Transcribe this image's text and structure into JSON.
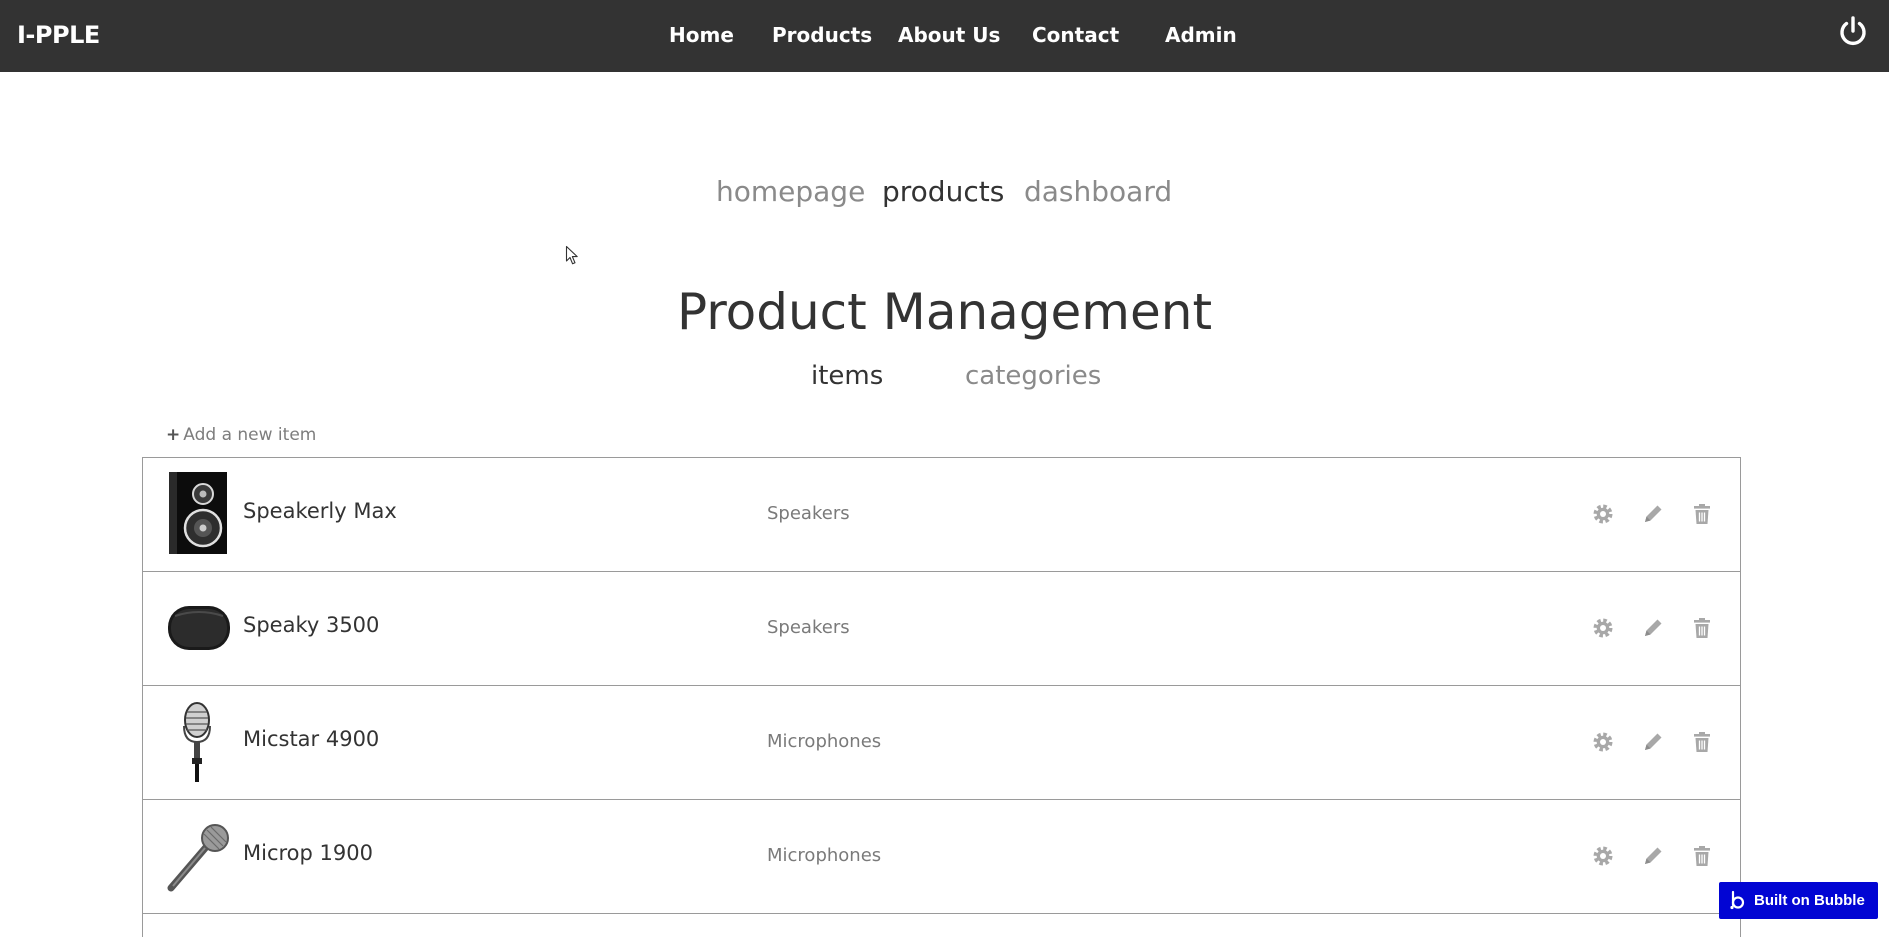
{
  "header": {
    "brand": "I-PPLE",
    "nav": [
      {
        "label": "Home"
      },
      {
        "label": "Products"
      },
      {
        "label": "About Us"
      },
      {
        "label": "Contact"
      },
      {
        "label": "Admin"
      }
    ],
    "power_icon": "power-icon"
  },
  "page_tabs": [
    {
      "label": "homepage",
      "active": false
    },
    {
      "label": "products",
      "active": true
    },
    {
      "label": "dashboard",
      "active": false
    }
  ],
  "main": {
    "title": "Product Management",
    "sub_tabs": [
      {
        "label": "items",
        "active": true
      },
      {
        "label": "categories",
        "active": false
      }
    ],
    "add_item_icon": "plus-icon",
    "add_item_label": "Add a new item",
    "products": [
      {
        "name": "Speakerly Max",
        "category": "Speakers",
        "image": "tower-speaker-image"
      },
      {
        "name": "Speaky 3500",
        "category": "Speakers",
        "image": "portable-speaker-image"
      },
      {
        "name": "Micstar 4900",
        "category": "Microphones",
        "image": "vintage-microphone-image"
      },
      {
        "name": "Microp 1900",
        "category": "Microphones",
        "image": "handheld-microphone-image"
      }
    ],
    "row_actions": [
      "gear-icon",
      "pencil-icon",
      "trash-icon"
    ]
  },
  "badge": {
    "label": "Built on Bubble",
    "icon": "bubble-logo-icon",
    "color": "#0205d3"
  },
  "colors": {
    "topbar": "#333333",
    "text": "#333333",
    "muted": "#8a8a8a",
    "icon_gray": "#a8a8a8"
  }
}
